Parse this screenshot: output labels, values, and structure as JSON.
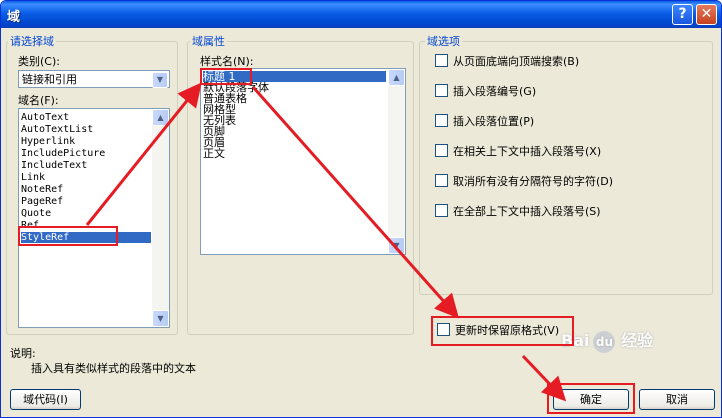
{
  "window": {
    "title": "域",
    "help": "?",
    "close": "✕"
  },
  "select_group": {
    "title": "请选择域",
    "category_label": "类别(C):",
    "category_value": "链接和引用",
    "fieldname_label": "域名(F):",
    "fields": [
      "AutoText",
      "AutoTextList",
      "Hyperlink",
      "IncludePicture",
      "IncludeText",
      "Link",
      "NoteRef",
      "PageRef",
      "Quote",
      "Ref",
      "StyleRef"
    ],
    "selected": "StyleRef"
  },
  "props_group": {
    "title": "域属性",
    "style_label": "样式名(N):",
    "styles": [
      "标题 1",
      "默认段落字体",
      "普通表格",
      "网格型",
      "无列表",
      "页脚",
      "页眉",
      "正文"
    ],
    "selected": "标题 1"
  },
  "options_group": {
    "title": "域选项",
    "options": [
      "从页面底端向顶端搜索(B)",
      "插入段落编号(G)",
      "插入段落位置(P)",
      "在相关上下文中插入段落号(X)",
      "取消所有没有分隔符号的字符(D)",
      "在全部上下文中插入段落号(S)"
    ],
    "preserve_format": "更新时保留原格式(V)"
  },
  "description": {
    "label": "说明:",
    "text": "插入具有类似样式的段落中的文本"
  },
  "buttons": {
    "field_codes": "域代码(I)",
    "ok": "确定",
    "cancel": "取消"
  },
  "watermark": {
    "text": "Bai",
    "text2": "经验",
    "paw": "du"
  },
  "colors": {
    "annotation": "#e51c23",
    "titlebar": "#0b5ee6",
    "selection": "#316ac5"
  }
}
